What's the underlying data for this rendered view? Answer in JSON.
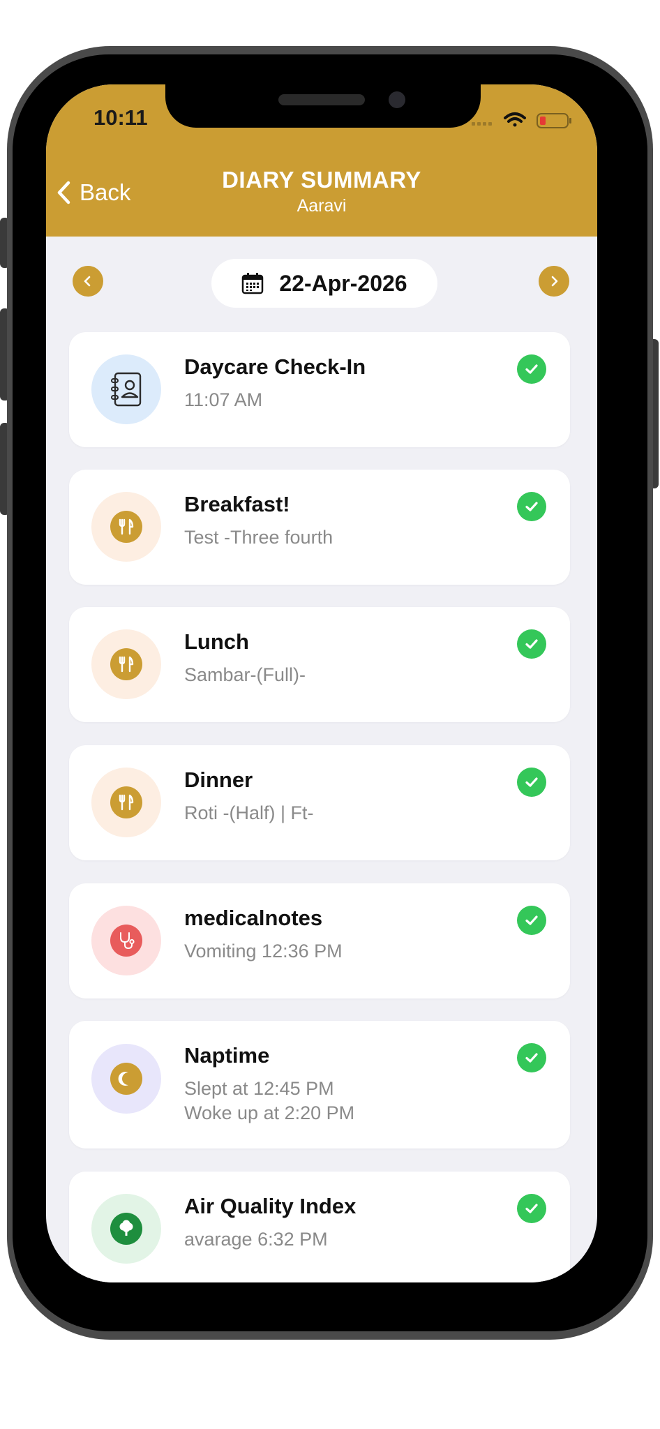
{
  "status_bar": {
    "time": "10:11"
  },
  "header": {
    "back_label": "Back",
    "title": "DIARY SUMMARY",
    "subtitle": "Aaravi"
  },
  "date_nav": {
    "date": "22-Apr-2026"
  },
  "entries": [
    {
      "title": "Daycare Check-In",
      "line1": "11:07 AM",
      "line2": "",
      "icon": "contact-book-icon",
      "icon_bg": "#dcebfb"
    },
    {
      "title": "Breakfast!",
      "line1": "Test -Three fourth",
      "line2": "",
      "icon": "fork-knife-icon",
      "icon_bg": "#fdeee2"
    },
    {
      "title": "Lunch",
      "line1": "Sambar-(Full)-",
      "line2": "",
      "icon": "fork-knife-icon",
      "icon_bg": "#fdeee2"
    },
    {
      "title": "Dinner",
      "line1": "Roti -(Half) | Ft-",
      "line2": "",
      "icon": "fork-knife-icon",
      "icon_bg": "#fdeee2"
    },
    {
      "title": "medicalnotes",
      "line1": "Vomiting 12:36 PM",
      "line2": "",
      "icon": "stethoscope-icon",
      "icon_bg": "#fde0e0"
    },
    {
      "title": "Naptime",
      "line1": "Slept at 12:45 PM",
      "line2": "Woke up at 2:20 PM",
      "icon": "moon-icon",
      "icon_bg": "#e8e6fb"
    },
    {
      "title": "Air Quality Index",
      "line1": "avarage 6:32 PM",
      "line2": "",
      "icon": "tree-icon",
      "icon_bg": "#e2f4e6"
    }
  ],
  "colors": {
    "accent": "#cb9d33",
    "check": "#34c759",
    "background": "#f0f0f5"
  }
}
